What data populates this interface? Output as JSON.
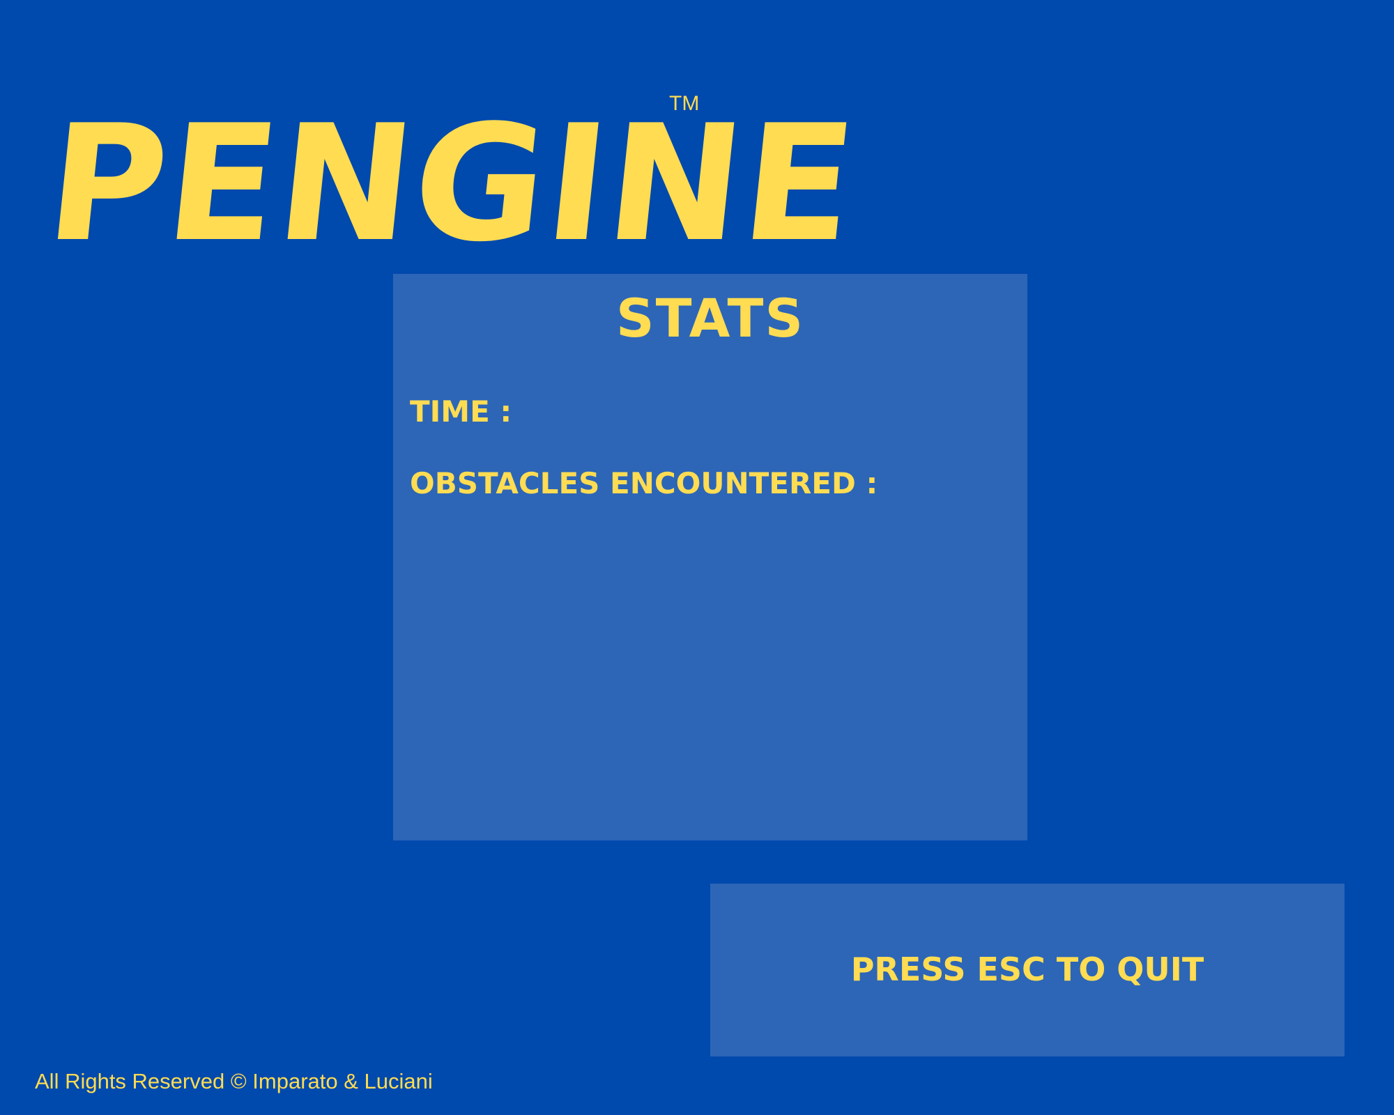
{
  "logo": {
    "title": "PENGINE",
    "trademark": "TM"
  },
  "stats": {
    "title": "STATS",
    "time_label": "TIME :",
    "obstacles_label": "OBSTACLES ENCOUNTERED :"
  },
  "quit": {
    "label": "PRESS ESC TO QUIT"
  },
  "footer": {
    "text": "All Rights Reserved © Imparato & Luciani"
  },
  "colors": {
    "background": "#0049ad",
    "panel": "#2d66b7",
    "accent_text": "#ffdc52"
  }
}
